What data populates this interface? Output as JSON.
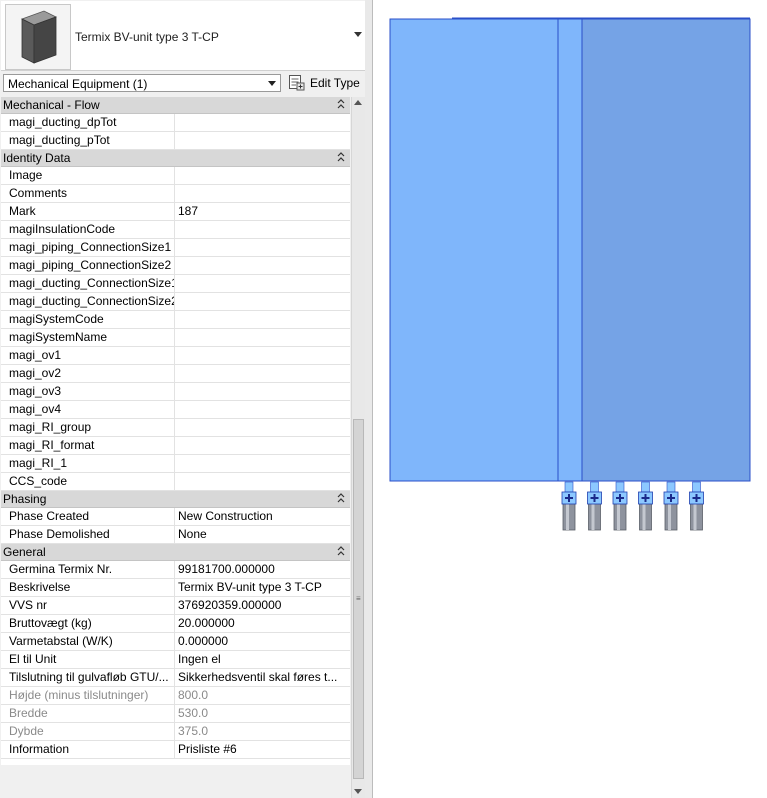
{
  "type_selector": {
    "name": "Termix BV-unit type 3 T-CP",
    "thumbnail_icon": "box-family-icon"
  },
  "instance_filter": {
    "label": "Mechanical Equipment (1)"
  },
  "edit_type": {
    "label": "Edit Type",
    "icon": "edit-type-icon"
  },
  "groups": [
    {
      "name": "Mechanical - Flow",
      "rows": [
        {
          "name": "magi_ducting_dpTot",
          "value": ""
        },
        {
          "name": "magi_ducting_pTot",
          "value": ""
        }
      ]
    },
    {
      "name": "Identity Data",
      "rows": [
        {
          "name": "Image",
          "value": ""
        },
        {
          "name": "Comments",
          "value": ""
        },
        {
          "name": "Mark",
          "value": "187"
        },
        {
          "name": "magiInsulationCode",
          "value": ""
        },
        {
          "name": "magi_piping_ConnectionSize1",
          "value": ""
        },
        {
          "name": "magi_piping_ConnectionSize2",
          "value": ""
        },
        {
          "name": "magi_ducting_ConnectionSize1",
          "value": ""
        },
        {
          "name": "magi_ducting_ConnectionSize2",
          "value": ""
        },
        {
          "name": "magiSystemCode",
          "value": ""
        },
        {
          "name": "magiSystemName",
          "value": ""
        },
        {
          "name": "magi_ov1",
          "value": ""
        },
        {
          "name": "magi_ov2",
          "value": ""
        },
        {
          "name": "magi_ov3",
          "value": ""
        },
        {
          "name": "magi_ov4",
          "value": ""
        },
        {
          "name": "magi_RI_group",
          "value": ""
        },
        {
          "name": "magi_RI_format",
          "value": ""
        },
        {
          "name": "magi_RI_1",
          "value": ""
        },
        {
          "name": "CCS_code",
          "value": ""
        }
      ]
    },
    {
      "name": "Phasing",
      "rows": [
        {
          "name": "Phase Created",
          "value": "New Construction"
        },
        {
          "name": "Phase Demolished",
          "value": "None"
        }
      ]
    },
    {
      "name": "General",
      "rows": [
        {
          "name": "Germina Termix Nr.",
          "value": "99181700.000000"
        },
        {
          "name": "Beskrivelse",
          "value": "Termix BV-unit type 3 T-CP"
        },
        {
          "name": "VVS nr",
          "value": "376920359.000000"
        },
        {
          "name": "Bruttovægt (kg)",
          "value": "20.000000"
        },
        {
          "name": "Varmetabstal (W/K)",
          "value": "0.000000"
        },
        {
          "name": "El til Unit",
          "value": "Ingen el"
        },
        {
          "name": "Tilslutning til gulvafløb GTU/...",
          "value": "Sikkerhedsventil skal føres t..."
        },
        {
          "name": "Højde (minus tilslutninger)",
          "value": "800.0",
          "readonly": true
        },
        {
          "name": "Bredde",
          "value": "530.0",
          "readonly": true
        },
        {
          "name": "Dybde",
          "value": "375.0",
          "readonly": true
        },
        {
          "name": "Information",
          "value": "Prisliste #6"
        }
      ]
    }
  ],
  "colors": {
    "unit_left": "#7fb6fb",
    "unit_right": "#75a3e6",
    "unit_edge": "#2a4fc8",
    "connector": "#8cc8ff",
    "pipe": "#8e939e"
  },
  "viewport": {
    "connectors_count": 6
  }
}
